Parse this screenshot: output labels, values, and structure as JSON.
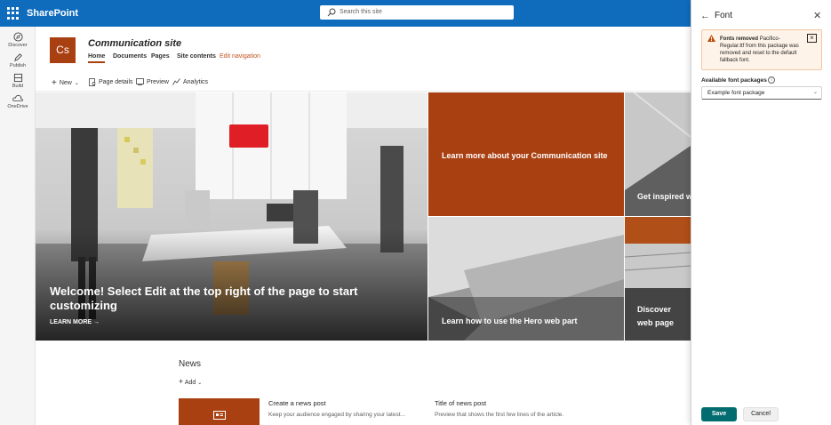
{
  "app": {
    "name": "SharePoint"
  },
  "search": {
    "placeholder": "Search this site"
  },
  "rail": [
    {
      "label": "Discover",
      "icon": "compass-icon"
    },
    {
      "label": "Publish",
      "icon": "pencil-icon"
    },
    {
      "label": "Build",
      "icon": "build-icon"
    },
    {
      "label": "OneDrive",
      "icon": "cloud-icon"
    }
  ],
  "site": {
    "logo_text": "Cs",
    "title": "Communication site",
    "nav": [
      "Home",
      "Documents",
      "Pages",
      "Site contents",
      "Edit navigation"
    ]
  },
  "commands": {
    "new": "New",
    "page_details": "Page details",
    "preview": "Preview",
    "analytics": "Analytics"
  },
  "hero": {
    "main_title": "Welcome! Select Edit at the top right of the page to start customizing",
    "main_link": "LEARN MORE",
    "tile1": "Learn more about your Communication site",
    "tile2": "Get inspired w",
    "tile3": "Learn how to use the Hero web part",
    "tile4": "Discover web page",
    "accent_color": "#a94012"
  },
  "news": {
    "heading": "News",
    "add_label": "Add",
    "item1_title": "Create a news post",
    "item1_summary": "Keep your audience engaged by sharing your latest...",
    "item2_title": "Title of news post",
    "item2_summary": "Preview that shows the first few lines of the article."
  },
  "panel": {
    "title": "Font",
    "warning_title": "Fonts removed",
    "warning_body": "Pacifico-Regular.ttf from this package was removed and reset to the default fallback font.",
    "packages_label": "Available font packages",
    "selected_package": "Example font package",
    "save": "Save",
    "cancel": "Cancel"
  }
}
